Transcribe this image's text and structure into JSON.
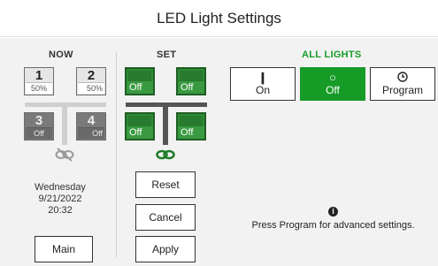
{
  "title": "LED Light Settings",
  "now": {
    "header": "NOW",
    "lights": [
      {
        "number": "1",
        "level": "50%"
      },
      {
        "number": "2",
        "level": "50%"
      },
      {
        "number": "3",
        "level": "Off"
      },
      {
        "number": "4",
        "level": "Off"
      }
    ],
    "day": "Wednesday",
    "date": "9/21/2022",
    "time": "20:32",
    "main_label": "Main"
  },
  "set": {
    "header": "SET",
    "lights": [
      {
        "level": "Off"
      },
      {
        "level": "Off"
      },
      {
        "level": "Off"
      },
      {
        "level": "Off"
      }
    ],
    "reset_label": "Reset",
    "cancel_label": "Cancel",
    "apply_label": "Apply"
  },
  "all_lights": {
    "header": "ALL LIGHTS",
    "header_color": "#169b27",
    "buttons": [
      {
        "label": "On",
        "icon": "power-on-icon"
      },
      {
        "label": "Off",
        "icon": "power-off-icon",
        "active": true
      },
      {
        "label": "Program",
        "icon": "clock-icon"
      }
    ],
    "info_text": "Press Program for advanced settings."
  },
  "colors": {
    "active_green": "#169b27",
    "tile_green": "#2e8b36"
  }
}
